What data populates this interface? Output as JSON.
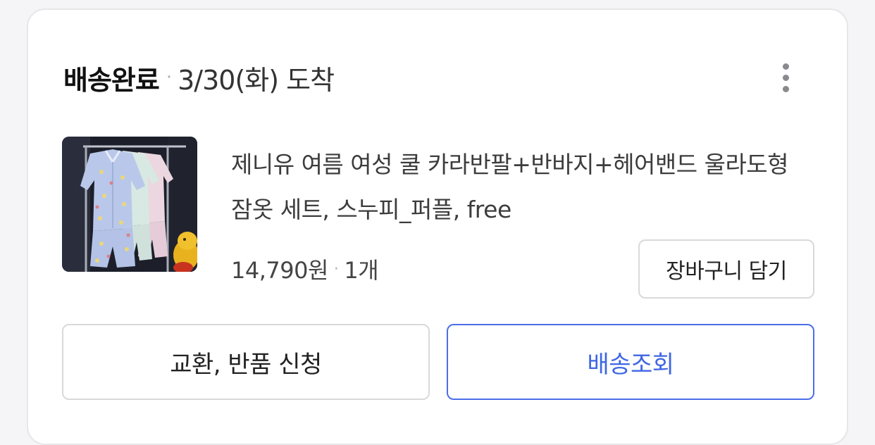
{
  "order": {
    "status": "배송완료",
    "separator": "·",
    "arrival": "3/30(화) 도착"
  },
  "menu": {
    "icon": "more-vertical-icon"
  },
  "product": {
    "image_icon": "product-thumbnail",
    "title": "제니유 여름 여성 쿨 카라반팔+반바지+헤어밴드 울라도형 잠옷 세트, 스누피_퍼플, free",
    "price": "14,790원",
    "separator": "·",
    "quantity": "1개"
  },
  "buttons": {
    "add_to_cart": "장바구니 담기",
    "return_request": "교환, 반품 신청",
    "track_delivery": "배송조회"
  },
  "colors": {
    "accent": "#3f66e3",
    "border": "#d9d9dc"
  }
}
